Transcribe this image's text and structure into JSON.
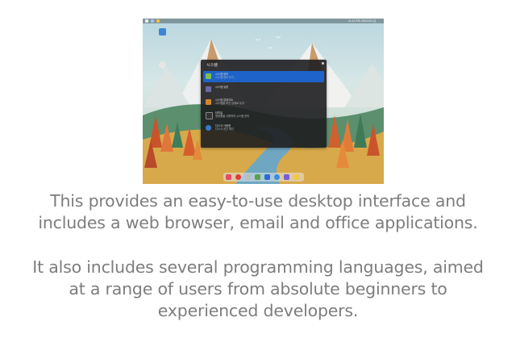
{
  "screenshot": {
    "clock_text": "11:11 PM, 09/11/24 금",
    "menu": {
      "title": "시스템",
      "items": [
        {
          "title": "시스템 정보",
          "subtitle": "시스템 정보 보기",
          "icon": "monitor-icon",
          "color": "#7fbf4a",
          "selected": true
        },
        {
          "title": "시스템 설정",
          "subtitle": "",
          "icon": "settings-icon",
          "color": "#6a6aa8",
          "selected": false
        },
        {
          "title": "시스템 업데이트",
          "subtitle": "시스템을 최신 상태로 유지",
          "icon": "update-icon",
          "color": "#d0862f",
          "selected": false
        },
        {
          "title": "터미널",
          "subtitle": "명령줄을 사용하여 시스템 관리",
          "icon": "terminal-icon",
          "color": "#333333",
          "selected": false
        },
        {
          "title": "디스크 사용량",
          "subtitle": "디스크 공간 확인",
          "icon": "disk-icon",
          "color": "#3a79c9",
          "selected": false
        }
      ]
    },
    "dock_icons": [
      {
        "name": "raspberry-icon",
        "color": "#e84a6a"
      },
      {
        "name": "power-icon",
        "color": "#e23b3b"
      },
      {
        "name": "trash-icon",
        "color": "#b9bec2"
      },
      {
        "name": "files-icon",
        "color": "#5aa24b"
      },
      {
        "name": "app-icon",
        "color": "#2b6bd1"
      },
      {
        "name": "browser-icon",
        "color": "#3b8de0"
      },
      {
        "name": "media-icon",
        "color": "#7a5cd6"
      },
      {
        "name": "folder-icon",
        "color": "#f2c64b"
      }
    ]
  },
  "caption": {
    "paragraph1": [
      "This provides an easy-to-use desktop interface and",
      "includes a web browser, email and office applications."
    ],
    "paragraph2": [
      "It also includes several programming languages, aimed",
      "at a range of users from absolute beginners to",
      "experienced developers."
    ]
  }
}
